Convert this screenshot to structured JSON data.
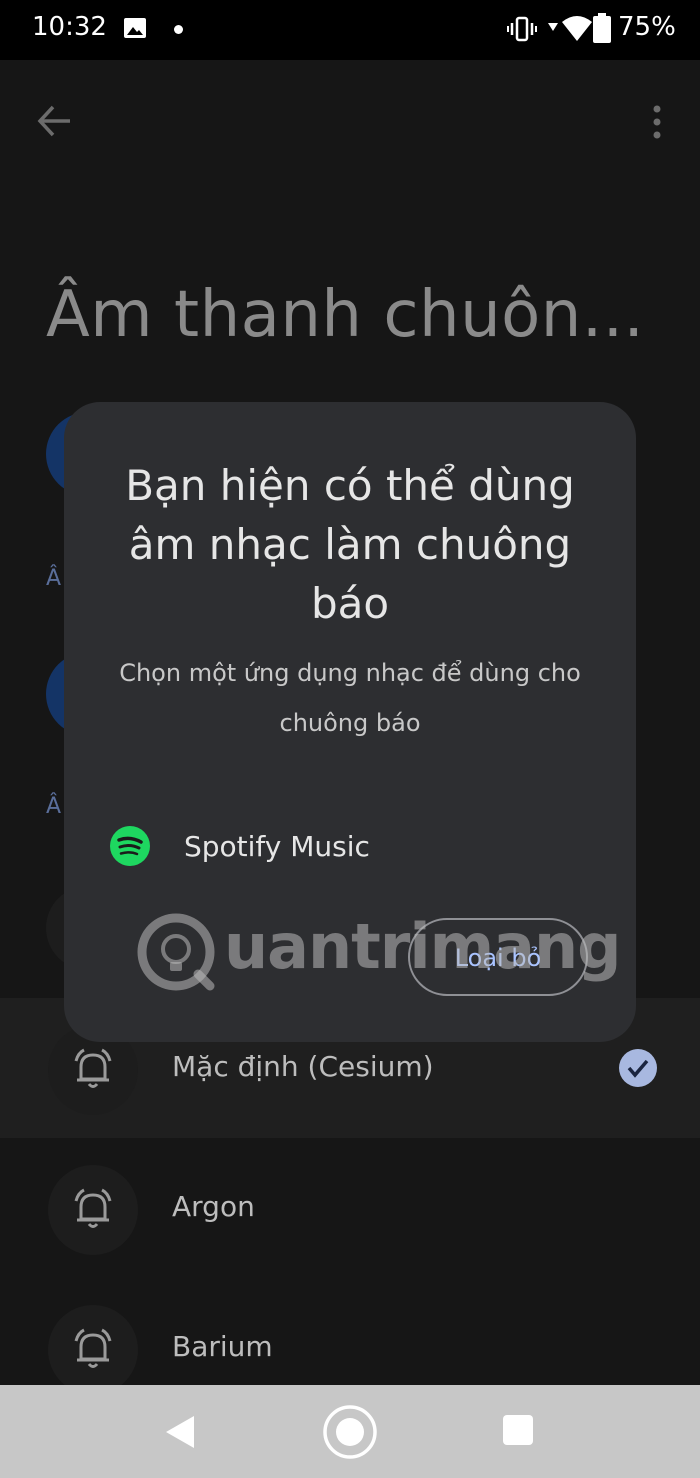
{
  "status_bar": {
    "time": "10:32",
    "battery": "75%"
  },
  "page": {
    "title": "Âm thanh chuôn..."
  },
  "background": {
    "section_letter_1": "Â",
    "section_letter_2": "Â"
  },
  "dialog": {
    "title": "Bạn hiện có thể dùng âm nhạc làm chuông báo",
    "subtitle": "Chọn một ứng dụng nhạc để dùng cho chuông báo",
    "app_option": "Spotify Music",
    "dismiss_label": "Loại bỏ"
  },
  "ringtones": [
    {
      "label": "Mặc định (Cesium)",
      "selected": true
    },
    {
      "label": "Argon",
      "selected": false
    },
    {
      "label": "Barium",
      "selected": false
    }
  ],
  "watermark": {
    "text": "uantrimang"
  },
  "colors": {
    "accent": "#a9c3ff",
    "spotify": "#1ed760",
    "check": "#a8b8e0"
  }
}
